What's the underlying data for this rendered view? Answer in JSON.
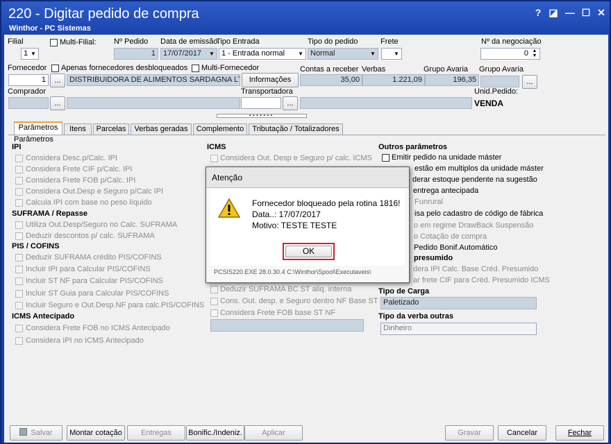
{
  "window": {
    "title": "220 - Digitar pedido de compra",
    "subtitle": "Winthor - PC Sistemas",
    "controls": {
      "help": "?",
      "restore": "◪",
      "minimize": "—",
      "maximize": "☐",
      "close": "✕"
    }
  },
  "header": {
    "filial_label": "Filial",
    "filial_value": "1",
    "multifilial_label": "Multi-Filial:",
    "npedido_label": "Nº Pedido",
    "npedido_value": "1",
    "data_emissao_label": "Data de emissão",
    "data_emissao_value": "17/07/2017",
    "tipo_entrada_label": "Tipo Entrada",
    "tipo_entrada_value": "1 - Entrada normal",
    "tipo_pedido_label": "Tipo do pedido",
    "tipo_pedido_value": "Normal",
    "frete_label": "Frete",
    "frete_value": "",
    "negociacao_label": "Nº da negociação",
    "negociacao_value": "0",
    "fornecedor_label": "Fornecedor",
    "apenas_desbloq_label": "Apenas fornecedores desbloqueados",
    "multi_fornecedor_label": "Multi-Fornecedor",
    "fornecedor_code": "1",
    "fornecedor_name": "DISTRIBUIDORA DE ALIMENTOS SARDAGNA LTDA",
    "informacoes_label": "Informações",
    "contas_receber_label": "Contas a receber",
    "contas_receber_value": "35,00",
    "verbas_label": "Verbas",
    "verbas_value": "1.221,09",
    "grupo_avaria_label": "Grupo Avaria",
    "grupo_avaria_value": "196,35",
    "grupo_avaria2_label": "Grupo Avaria",
    "comprador_label": "Comprador",
    "transportadora_label": "Transportadora",
    "unid_pedido_label": "Unid.Pedido:",
    "unid_pedido_value": "VENDA",
    "ellipsis": "..."
  },
  "tabs": [
    "Parâmetros",
    "Itens",
    "Parcelas",
    "Verbas geradas",
    "Complemento",
    "Tributação / Totalizadores"
  ],
  "params": {
    "section_title": "Parâmetros",
    "ipi": {
      "title": "IPI",
      "items": [
        "Considera Desc.p/Calc. IPI",
        "Considera Frete CIF p/Calc. IPI",
        "Considera Frete FOB p/Calc. IPI",
        "Considera Out.Desp e Seguro p/Calc IPI",
        "Calcula IPI com base no peso líquido"
      ]
    },
    "suframa": {
      "title": "SUFRAMA / Repasse",
      "items": [
        "Utiliza Out.Desp/Seguro no Calc. SUFRAMA",
        "Deduzir descontos p/ calc. SUFRAMA"
      ]
    },
    "pis": {
      "title": "PIS / COFINS",
      "items": [
        "Deduzir SUFRAMA crédito PIS/COFINS",
        "Incluir IPI para Calcular PIS/COFINS",
        "Incluir ST NF para Calcular PIS/COFINS",
        "Incluir ST Guia para Calcular PIS/COFINS",
        "Incluir Seguro e Out.Desp.NF para calc.PIS/COFINS"
      ]
    },
    "icms_ant": {
      "title": "ICMS Antecipado",
      "items": [
        "Considera Frete FOB no ICMS Antecipado",
        "Considera IPI no ICMS Antecipado"
      ]
    },
    "icms": {
      "title": "ICMS",
      "items_top": [
        "Considera Out. Desp e Seguro p/ calc. ICMS"
      ],
      "items_bottom": [
        "Deduzir SUFRAMA BC ST aliq. interna",
        "Cons. Out. desp. e Seguro dentro NF Base ST",
        "Considera Frete FOB base ST NF"
      ]
    },
    "outros": {
      "title": "Outros parâmetros",
      "items": [
        "Emitir pedido na unidade máster",
        "estão em multiplos da unidade máster",
        "derar estoque pendente na sugestão",
        "entrega antecipada",
        "Funrural",
        "isa pelo cadastro de código de fábrica",
        "o em regime DrawBack Suspensão",
        "o Cotação de compra",
        "Pedido Bonif.Automático"
      ]
    },
    "presumido": {
      "title": "presumido",
      "items": [
        "dera IPI Calc. Base Créd. Presumido",
        "ar frete CIF para Créd. Presumido ICMS"
      ]
    },
    "tipo_carga": {
      "title": "Tipo de Carga",
      "value": "Paletizado"
    },
    "tipo_verba": {
      "title": "Tipo da verba outras",
      "value": "Dinheiro"
    }
  },
  "dialog": {
    "title": "Atenção",
    "line1": "Fornecedor bloqueado pela rotina 1816!",
    "line2": "Data..: 17/07/2017",
    "line3": "Motivo: TESTE TESTE",
    "ok_label": "OK",
    "footer": "PCSIS220.EXE 28.0.30.4 C:\\Winthor\\Spool\\Executaveis\\"
  },
  "footer": {
    "salvar": "Salvar",
    "montar": "Montar cotação",
    "entregas": "Entregas",
    "bonific": "Bonific./Indeniz.",
    "aplicar": "Aplicar",
    "gravar": "Gravar",
    "cancelar": "Cancelar",
    "fechar": "Fechar"
  },
  "colors": {
    "titlebar": "#1a44ad",
    "readonly": "#c8d4e0",
    "tab_accent": "#f2a22a",
    "ok_border": "#d0202a"
  }
}
